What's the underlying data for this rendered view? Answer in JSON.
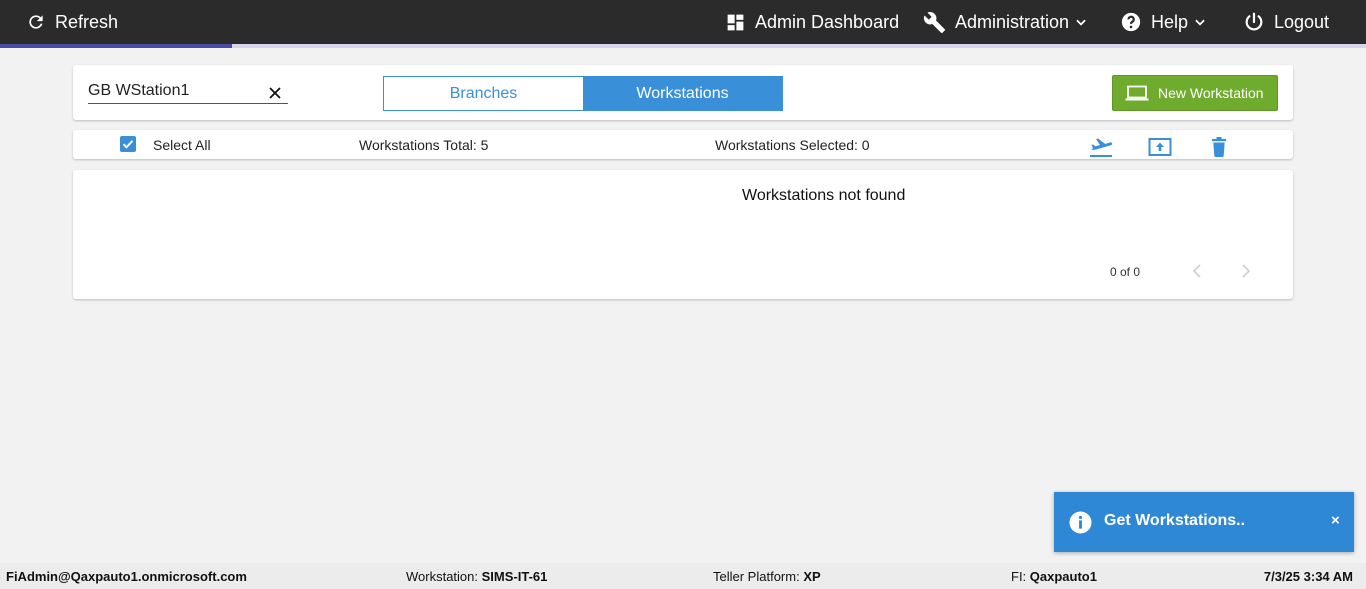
{
  "header": {
    "refresh_label": "Refresh",
    "admin_dashboard_label": "Admin Dashboard",
    "administration_label": "Administration",
    "help_label": "Help",
    "logout_label": "Logout",
    "loading_progress_fraction": 0.17
  },
  "filter": {
    "search_value": "GB WStation1",
    "tabs": [
      {
        "label": "Branches",
        "active": false
      },
      {
        "label": "Workstations",
        "active": true
      }
    ],
    "new_button_label": "New Workstation"
  },
  "toolbar": {
    "select_all_label": "Select All",
    "select_all_checked": true,
    "total_label": "Workstations Total: 5",
    "selected_label": "Workstations Selected: 0",
    "icons": [
      "flight-takeoff-icon",
      "upload-icon",
      "trash-icon"
    ]
  },
  "results": {
    "empty_message": "Workstations not found",
    "pagination_text": "0 of 0"
  },
  "toast": {
    "message": "Get Workstations..",
    "close_label": "×"
  },
  "status": {
    "user": "FiAdmin@Qaxpauto1.onmicrosoft.com",
    "workstation_label": "Workstation:",
    "workstation_value": "SIMS-IT-61",
    "platform_label": "Teller Platform:",
    "platform_value": "XP",
    "fi_label": "FI:",
    "fi_value": "Qaxpauto1",
    "datetime": "7/3/25 3:34 AM"
  },
  "colors": {
    "accent": "#3a8fd9",
    "topbar": "#2b2b2b",
    "new_button": "#6fab2c",
    "toast": "#2f88d6"
  }
}
